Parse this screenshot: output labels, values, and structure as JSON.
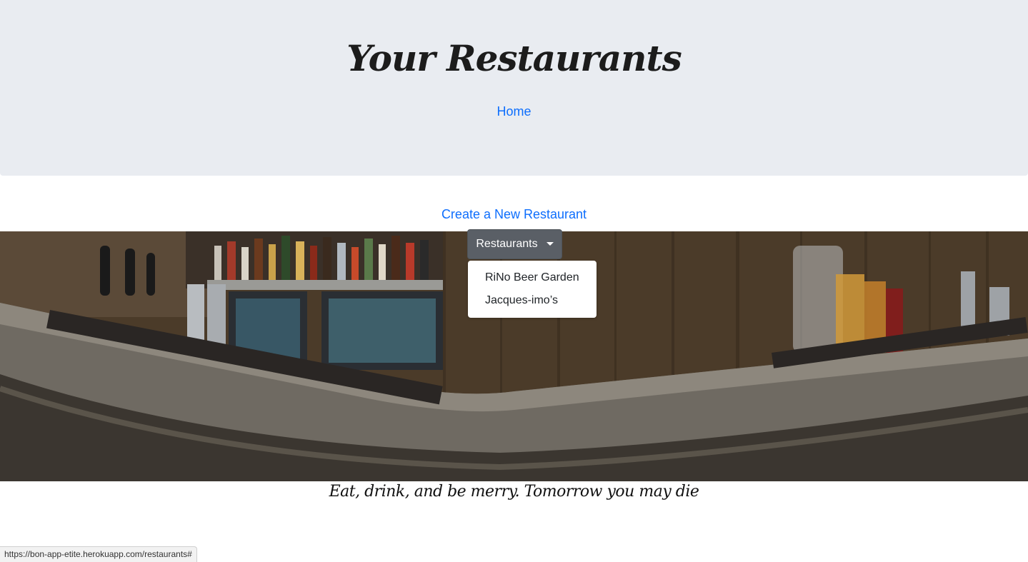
{
  "header": {
    "title": "Your Restaurants",
    "home_link": "Home"
  },
  "main": {
    "create_link": "Create a New Restaurant",
    "dropdown": {
      "label": "Restaurants",
      "items": [
        {
          "label": "RiNo Beer Garden"
        },
        {
          "label": "Jacques-imo’s"
        }
      ]
    },
    "tagline": "Eat, drink, and be merry. Tomorrow you may die"
  },
  "status_bar": {
    "url": "https://bon-app-etite.herokuapp.com/restaurants#"
  },
  "colors": {
    "header_bg": "#e9ecf1",
    "link": "#0d6efd",
    "dropdown_button": "#5a5f66"
  },
  "icons": {
    "dropdown_caret": "caret-down-icon"
  }
}
